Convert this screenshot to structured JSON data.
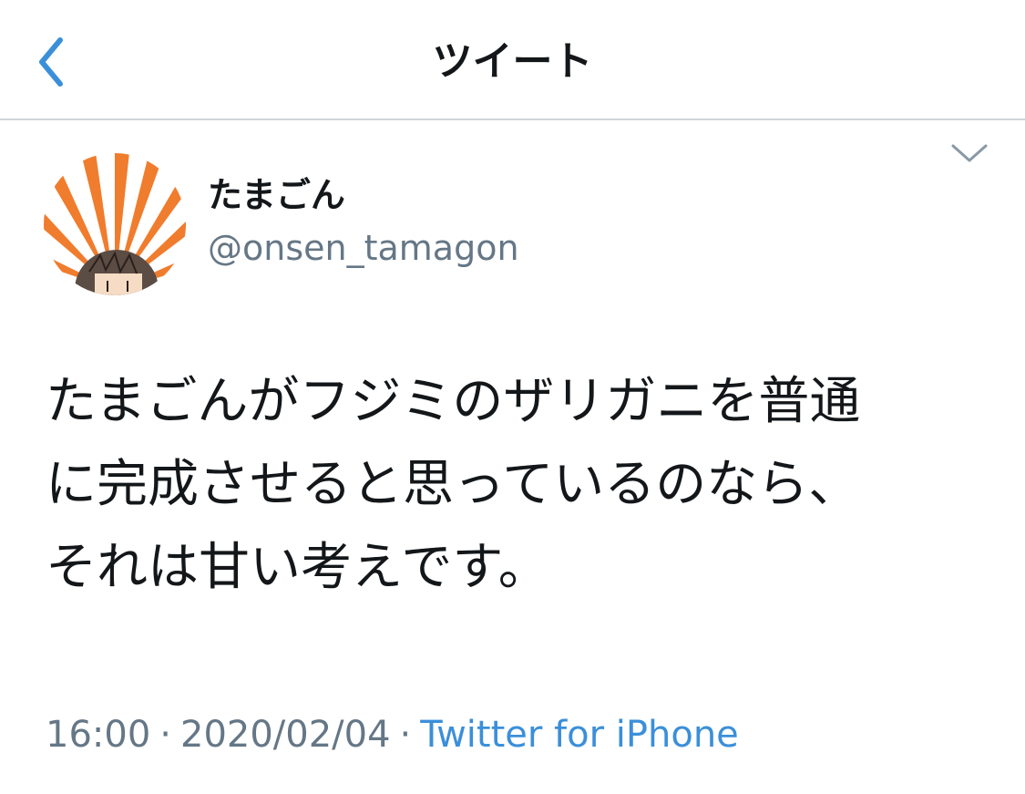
{
  "header": {
    "title": "ツイート",
    "back_icon": "chevron-left-icon"
  },
  "tweet": {
    "display_name": "たまごん",
    "handle": "@onsen_tamagon",
    "text_lines": [
      "たまごんがフジミのザリガニを普通",
      "に完成させると思っているのなら、",
      "それは甘い考えです。"
    ],
    "time": "16:00",
    "date": "2020/02/04",
    "separator": "·",
    "source": "Twitter for iPhone",
    "menu_icon": "chevron-down-icon"
  },
  "colors": {
    "accent": "#3b8fd9",
    "secondary_text": "#657786",
    "primary_text": "#14171a",
    "avatar_orange": "#f07c2d",
    "divider": "#d0d5d9"
  }
}
